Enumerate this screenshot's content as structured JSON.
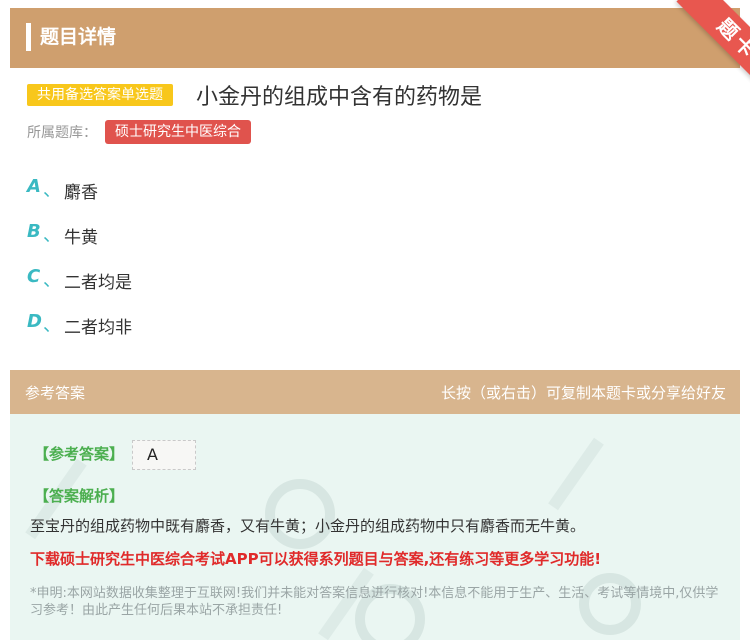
{
  "header": {
    "title": "题目详情",
    "ribbon": "题卡"
  },
  "question": {
    "type": "共用备选答案单选题",
    "title": "小金丹的组成中含有的药物是",
    "bank_label": "所属题库：",
    "bank": "硕士研究生中医综合"
  },
  "options": [
    {
      "letter": "A",
      "sep": "、",
      "text": "麝香"
    },
    {
      "letter": "B",
      "sep": "、",
      "text": "牛黄"
    },
    {
      "letter": "C",
      "sep": "、",
      "text": "二者均是"
    },
    {
      "letter": "D",
      "sep": "、",
      "text": "二者均非"
    }
  ],
  "answer_header": {
    "left": "参考答案",
    "right": "长按（或右击）可复制本题卡或分享给好友"
  },
  "answer": {
    "ref_label": "【参考答案】",
    "ref_value": "A",
    "analysis_label": "【答案解析】",
    "analysis_text": "至宝丹的组成药物中既有麝香，又有牛黄；小金丹的组成药物中只有麝香而无牛黄。",
    "promo": "下载硕士研究生中医综合考试APP可以获得系列题目与答案,还有练习等更多学习功能!",
    "disclaimer": "*申明:本网站数据收集整理于互联网!我们并未能对答案信息进行核对!本信息不能用于生产、生活、考试等情境中,仅供学习参考！由此产生任何后果本站不承担责任!"
  },
  "colors": {
    "header": "#cf9f6e",
    "accent": "#3ab9c2",
    "tag": "#e0534d",
    "type": "#f8c71b",
    "green": "#4caf50",
    "red": "#e02a2a"
  }
}
